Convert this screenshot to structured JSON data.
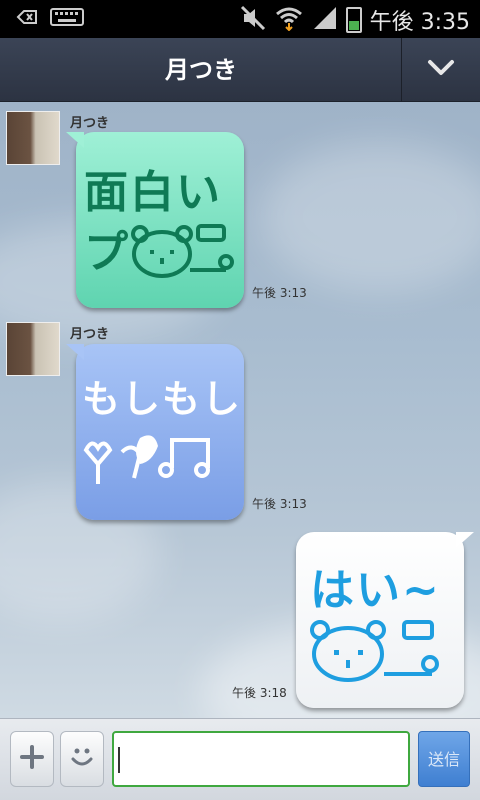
{
  "status_bar": {
    "time": "午後 3:35",
    "icons": [
      "back-icon",
      "keyboard-icon",
      "mute-icon",
      "wifi-icon",
      "signal-icon",
      "battery-icon"
    ],
    "battery_level_percent": 40
  },
  "header": {
    "title": "月つき",
    "dropdown_icon": "chevron-down-icon"
  },
  "messages": [
    {
      "direction": "incoming",
      "sender": "月つき",
      "sticker_text": "面白い",
      "sticker_text2": "プ",
      "timestamp": "午後 3:13",
      "bubble_color": "#7fe0c4",
      "text_color": "#0f7a55"
    },
    {
      "direction": "incoming",
      "sender": "月つき",
      "sticker_text": "もしもし",
      "timestamp": "午後 3:13",
      "bubble_color": "#8fb0f0",
      "text_color": "#ffffff"
    },
    {
      "direction": "outgoing",
      "sticker_text": "はい~",
      "timestamp": "午後 3:18",
      "bubble_color": "#ffffff",
      "text_color": "#1e9ee0"
    }
  ],
  "input_bar": {
    "plus_icon": "plus-icon",
    "emoticon_icon": "smiley-icon",
    "message_value": "",
    "send_label": "送信"
  }
}
